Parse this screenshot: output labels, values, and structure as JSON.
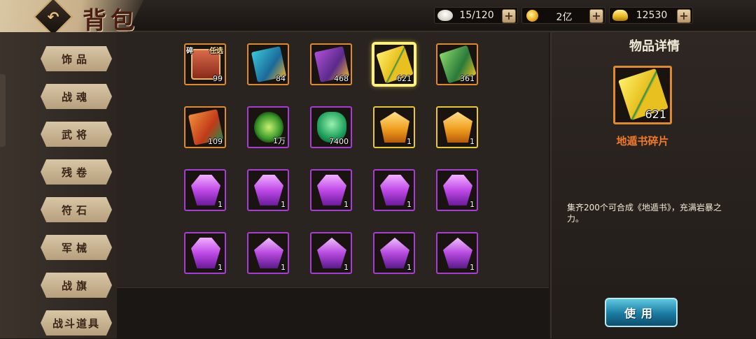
{
  "header": {
    "title": "背包",
    "resources": [
      {
        "icon": "steamed-bun-icon",
        "value": "15/120"
      },
      {
        "icon": "gold-coin-icon",
        "value": "2亿"
      },
      {
        "icon": "gold-ingot-icon",
        "value": "12530"
      }
    ],
    "plus_label": "+"
  },
  "sidebar": {
    "categories": [
      {
        "label": "饰品"
      },
      {
        "label": "战魂"
      },
      {
        "label": "武将"
      },
      {
        "label": "残卷"
      },
      {
        "label": "符石"
      },
      {
        "label": "军械"
      },
      {
        "label": "战旗"
      },
      {
        "label": "战斗道具"
      }
    ]
  },
  "grid": {
    "items": [
      {
        "icon": "treasure-chest-icon",
        "rarity": "orange",
        "count": "99",
        "badge": "碎",
        "badge2": "任选"
      },
      {
        "icon": "blue-book-icon",
        "rarity": "orange",
        "count": "84"
      },
      {
        "icon": "purple-book-icon",
        "rarity": "orange",
        "count": "468"
      },
      {
        "icon": "gold-scroll-fragment-icon",
        "rarity": "gold",
        "count": "621",
        "selected": true
      },
      {
        "icon": "green-scroll-icon",
        "rarity": "orange",
        "count": "361"
      },
      {
        "icon": "red-book-icon",
        "rarity": "orange",
        "count": "109"
      },
      {
        "icon": "green-orb-icon",
        "rarity": "purple",
        "count": "1万"
      },
      {
        "icon": "green-book-icon",
        "rarity": "purple",
        "count": "7400"
      },
      {
        "icon": "orange-gem-icon",
        "rarity": "gold",
        "count": "1"
      },
      {
        "icon": "orange-gem-icon",
        "rarity": "gold",
        "count": "1"
      },
      {
        "icon": "purple-crystal-icon",
        "rarity": "purple",
        "count": "1"
      },
      {
        "icon": "purple-crystal-icon",
        "rarity": "purple",
        "count": "1"
      },
      {
        "icon": "purple-crystal-icon",
        "rarity": "purple",
        "count": "1"
      },
      {
        "icon": "purple-crystal-icon",
        "rarity": "purple",
        "count": "1"
      },
      {
        "icon": "purple-crystal-icon",
        "rarity": "purple",
        "count": "1"
      },
      {
        "icon": "purple-crystal-icon",
        "rarity": "purple",
        "count": "1"
      },
      {
        "icon": "purple-rune-crystal-icon",
        "rarity": "purple",
        "count": "1"
      },
      {
        "icon": "purple-rune-crystal-icon",
        "rarity": "purple",
        "count": "1"
      },
      {
        "icon": "purple-rune-crystal-icon",
        "rarity": "purple",
        "count": "1"
      },
      {
        "icon": "purple-rune-crystal-icon",
        "rarity": "purple",
        "count": "1"
      }
    ]
  },
  "detail": {
    "title": "物品详情",
    "item_icon": "gold-scroll-fragment-icon",
    "item_count": "621",
    "item_name": "地遁书碎片",
    "description": "集齐200个可合成《地遁书》，充满岩暴之力。",
    "use_label": "使用"
  },
  "colors": {
    "orange_border": "#e08a2a",
    "purple_border": "#a83cd6",
    "gold_border": "#e8c82a",
    "item_name": "#f07a2a",
    "use_button": "#1a7aa0"
  }
}
